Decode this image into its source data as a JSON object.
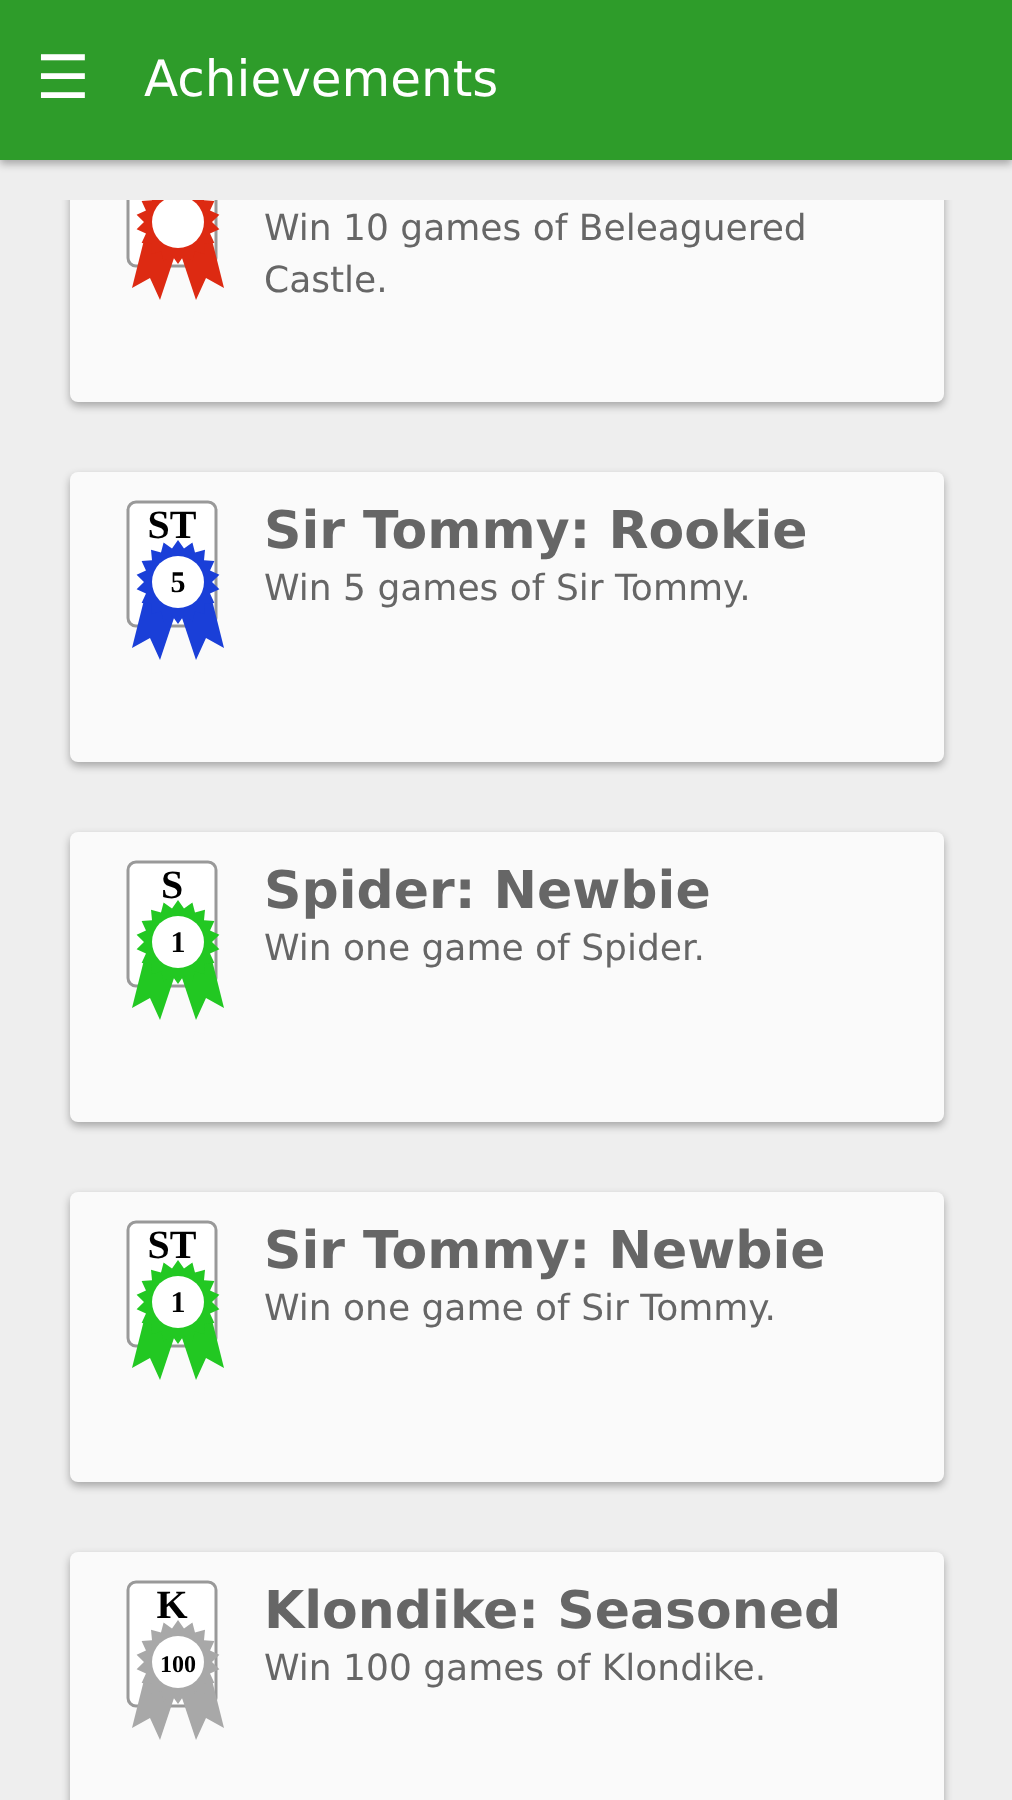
{
  "app_bar": {
    "menu_icon": "☰",
    "title": "Achievements"
  },
  "achievements": [
    {
      "description": "Win 10 games of Beleaguered Castle.",
      "color": "#dd2a12"
    },
    {
      "title": "Sir Tommy: Rookie",
      "description": "Win 5 games of Sir Tommy.",
      "badge_letters": "ST",
      "badge_number": "5",
      "color": "#1a3fd8"
    },
    {
      "title": "Spider: Newbie",
      "description": "Win one game of Spider.",
      "badge_letters": "S",
      "badge_number": "1",
      "color": "#22c822"
    },
    {
      "title": "Sir Tommy: Newbie",
      "description": "Win one game of Sir Tommy.",
      "badge_letters": "ST",
      "badge_number": "1",
      "color": "#22c822"
    },
    {
      "title": "Klondike: Seasoned",
      "description": "Win 100 games of Klondike.",
      "badge_letters": "K",
      "badge_number": "100",
      "color": "#a8a8a8"
    }
  ]
}
